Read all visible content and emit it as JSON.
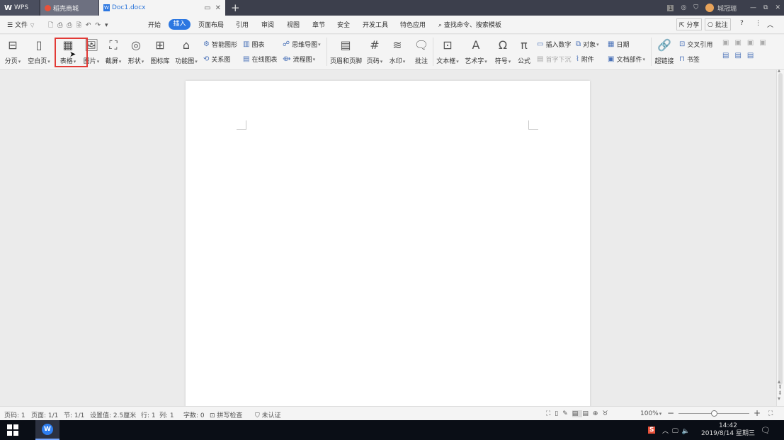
{
  "titlebar": {
    "tabs": [
      {
        "label": "WPS",
        "icon": "wps-logo-icon"
      },
      {
        "label": "稻壳商城",
        "icon": "daoke-icon"
      },
      {
        "label": "Doc1.docx",
        "icon": "word-doc-icon"
      }
    ],
    "user_name": "城冠瑞"
  },
  "menu": {
    "file": "文件",
    "tabs": [
      "开始",
      "插入",
      "页面布局",
      "引用",
      "审阅",
      "视图",
      "章节",
      "安全",
      "开发工具",
      "特色应用"
    ],
    "active_tab": "插入",
    "search_placeholder": "查找命令、搜索模板",
    "share": "分享",
    "annotate": "批注"
  },
  "toolbar": {
    "page_break": "分页",
    "blank_page": "空白页",
    "table": "表格",
    "picture": "图片",
    "screenshot": "截屏",
    "shape": "形状",
    "icon_lib": "图标库",
    "func_chart": "功能图",
    "smart_shape": "智能图形",
    "chart": "图表",
    "mindmap": "思维导图",
    "relation": "关系图",
    "online_chart": "在线图表",
    "flowchart": "流程图",
    "header_footer": "页眉和页脚",
    "page_number": "页码",
    "watermark": "水印",
    "comment": "批注",
    "textbox": "文本框",
    "art_text": "艺术字",
    "symbol": "符号",
    "formula": "公式",
    "insert_number": "插入数字",
    "object": "对象",
    "date": "日期",
    "drop_cap": "首字下沉",
    "attachment": "附件",
    "doc_parts": "文档部件",
    "hyperlink": "超链接",
    "cross_ref": "交叉引用",
    "bookmark": "书签"
  },
  "status": {
    "page_code": "页码: 1",
    "page": "页面: 1/1",
    "section": "节: 1/1",
    "setting": "设置值: 2.5厘米",
    "row": "行: 1",
    "col": "列: 1",
    "words": "字数: 0",
    "spell": "拼写检查",
    "cert": "未认证",
    "zoom": "100%",
    "zoom_level": 0.5
  },
  "taskbar": {
    "time": "14:42",
    "date": "2019/8/14 星期三"
  },
  "colors": {
    "accent": "#2c77e1",
    "highlight_box": "#e23a36",
    "titlebar": "#3c3f4c"
  }
}
